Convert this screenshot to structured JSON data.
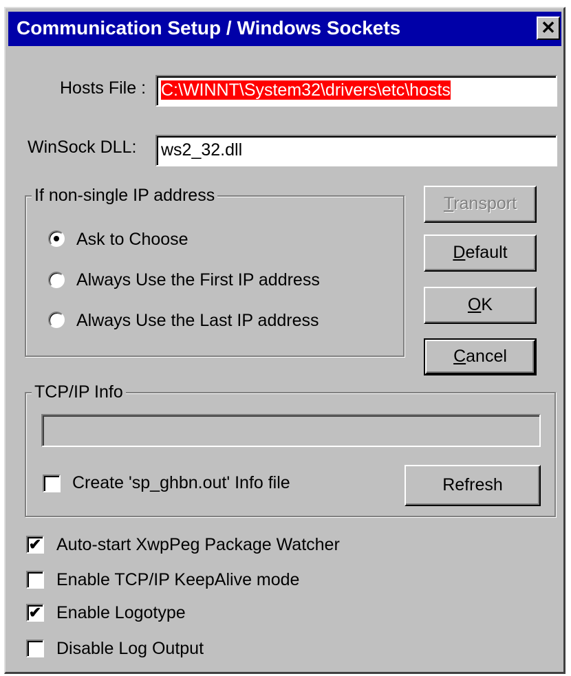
{
  "window": {
    "title": "Communication Setup / Windows Sockets",
    "close_glyph": "✕"
  },
  "hosts_file": {
    "label": "Hosts File :",
    "value": "C:\\WINNT\\System32\\drivers\\etc\\hosts"
  },
  "winsock_dll": {
    "label": "WinSock DLL:",
    "value": "ws2_32.dll"
  },
  "ip_group": {
    "title": "If non-single IP address",
    "options": [
      {
        "label": "Ask to Choose",
        "checked": true
      },
      {
        "label": "Always Use the First IP address",
        "checked": false
      },
      {
        "label": "Always Use the Last IP address",
        "checked": false
      }
    ]
  },
  "buttons": {
    "transport": {
      "label_underlined": "T",
      "label_rest": "ransport",
      "enabled": false
    },
    "default": {
      "label_underlined": "D",
      "label_rest": "efault"
    },
    "ok": {
      "label_underlined": "O",
      "label_rest": "K"
    },
    "cancel": {
      "label_underlined": "C",
      "label_rest": "ancel"
    },
    "refresh": {
      "label": "Refresh"
    }
  },
  "tcpip_group": {
    "title": "TCP/IP Info",
    "info_value": "",
    "create_file": {
      "label": "Create 'sp_ghbn.out' Info file",
      "checked": false
    }
  },
  "options": [
    {
      "label": "Auto-start XwpPeg Package Watcher",
      "checked": true
    },
    {
      "label": "Enable TCP/IP KeepAlive mode",
      "checked": false
    },
    {
      "label": "Enable Logotype",
      "checked": true
    },
    {
      "label": "Disable Log Output",
      "checked": false
    }
  ],
  "check_glyph": "✔",
  "colors": {
    "titlebar": "#0000a8",
    "dialog_face": "#c0c0c0",
    "selection_highlight": "#ff0000"
  }
}
